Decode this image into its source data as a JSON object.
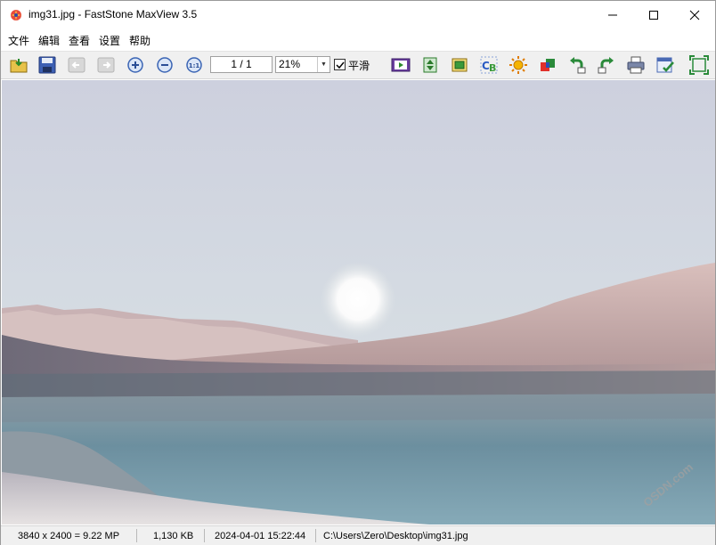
{
  "window": {
    "title": "img31.jpg - FastStone MaxView 3.5",
    "icon": "faststone-app-icon"
  },
  "menu": {
    "items": [
      "文件",
      "编辑",
      "查看",
      "设置",
      "帮助"
    ]
  },
  "toolbar": {
    "buttons": [
      {
        "name": "open-folder-icon"
      },
      {
        "name": "save-icon"
      },
      {
        "name": "previous-disabled-icon"
      },
      {
        "name": "next-disabled-icon"
      },
      {
        "name": "zoom-in-icon"
      },
      {
        "name": "zoom-out-icon"
      },
      {
        "name": "actual-size-icon"
      },
      {
        "name": "slideshow-icon"
      },
      {
        "name": "resize-image-icon"
      },
      {
        "name": "crop-icon"
      },
      {
        "name": "text-icon"
      },
      {
        "name": "brightness-icon"
      },
      {
        "name": "colors-icon"
      },
      {
        "name": "rotate-left-icon"
      },
      {
        "name": "rotate-right-icon"
      },
      {
        "name": "print-icon"
      },
      {
        "name": "settings-icon"
      },
      {
        "name": "fullscreen-icon"
      }
    ],
    "page_indicator": "1 / 1",
    "zoom_value": "21%",
    "smooth_label": "平滑",
    "smooth_checked": true
  },
  "status": {
    "dimensions": "3840 x 2400 = 9.22 MP",
    "file_size": "1,130 KB",
    "datetime": "2024-04-01 15:22:44",
    "path": "C:\\Users\\Zero\\Desktop\\img31.jpg"
  },
  "watermark": "OSDN.com",
  "colors": {
    "sky": "#cfd3dd",
    "dune": "#c7a9a6",
    "water": "#6d8f9f"
  }
}
